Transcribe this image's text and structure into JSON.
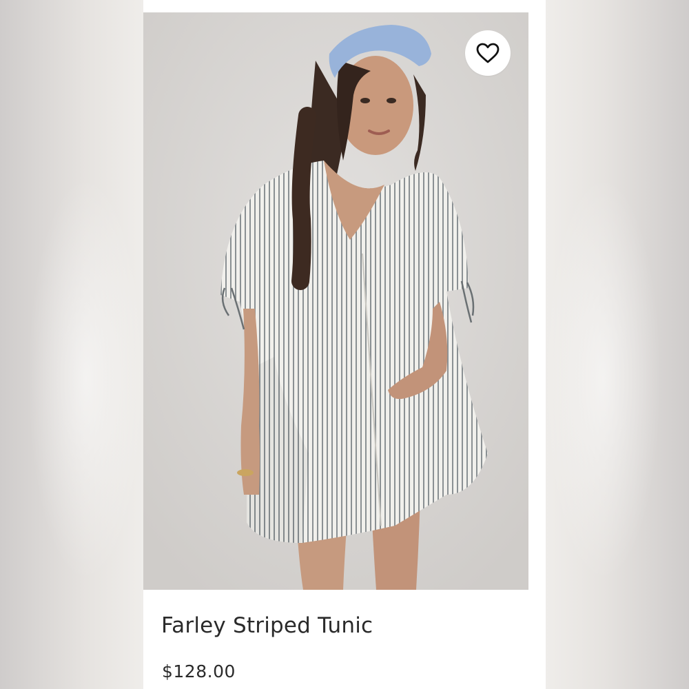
{
  "product": {
    "image_alt": "Model wearing striped button-front tunic with blue headscarf",
    "title": "Farley Striped Tunic",
    "price": "$128.00"
  },
  "favorite": {
    "icon": "heart-icon",
    "state": "not-favorited"
  },
  "colors": {
    "page_background": "#ebe9e6",
    "card_background": "#ffffff",
    "text": "#2a2a2a",
    "photo_background": "#dcdad8",
    "headscarf": "#98b3da",
    "stripe": "#7f8588"
  }
}
